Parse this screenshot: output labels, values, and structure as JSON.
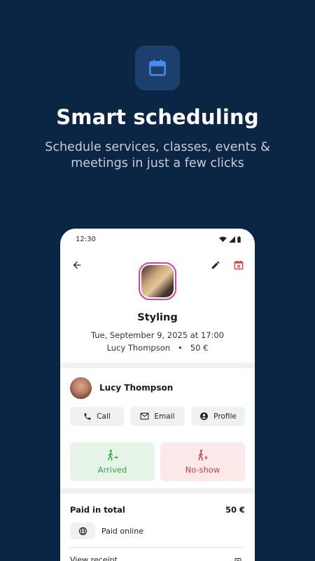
{
  "hero": {
    "title": "Smart scheduling",
    "subtitle": "Schedule services, classes, events & meetings in just a few clicks",
    "icon": "calendar-icon",
    "accent": "#4a8df0"
  },
  "phone": {
    "status_time": "12:30",
    "appointment": {
      "service": "Styling",
      "datetime": "Tue, September 9, 2025 at 17:00",
      "client": "Lucy Thompson",
      "separator": "•",
      "price": "50 €"
    },
    "client_card": {
      "name": "Lucy Thompson",
      "actions": [
        {
          "label": "Call",
          "icon": "phone-icon"
        },
        {
          "label": "Email",
          "icon": "mail-icon"
        },
        {
          "label": "Profile",
          "icon": "account-icon"
        }
      ]
    },
    "attendance": {
      "arrived_label": "Arrived",
      "noshow_label": "No-show",
      "arrived_color": "#2fa844",
      "noshow_color": "#e0393e"
    },
    "payment": {
      "label": "Paid in total",
      "amount": "50 €",
      "method": "Paid online",
      "receipt_label": "View receipt"
    }
  }
}
